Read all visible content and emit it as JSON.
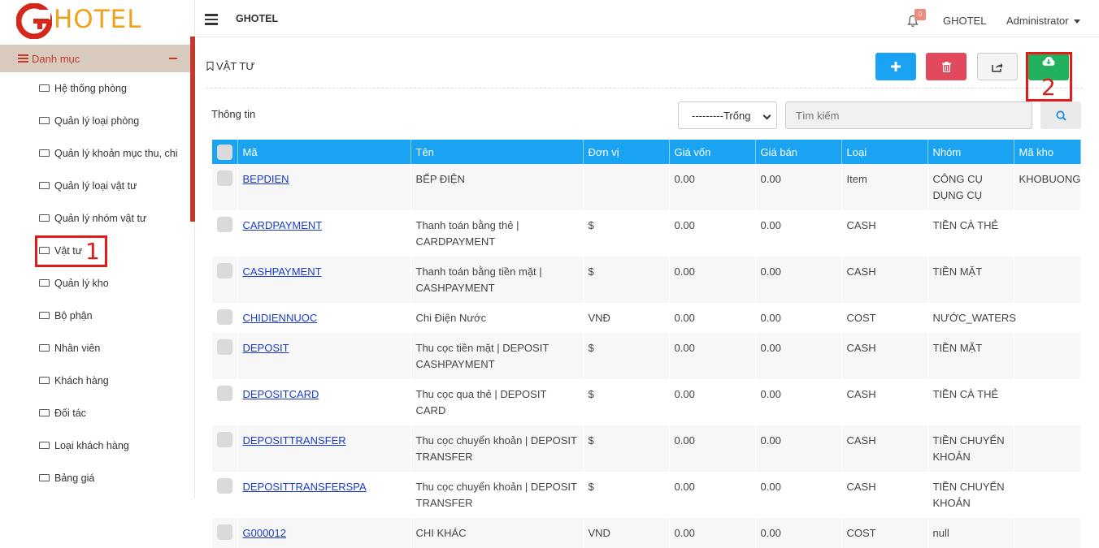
{
  "logo": {
    "text": "HOTEL"
  },
  "sidebar": {
    "header": "Danh mục",
    "items": [
      {
        "label": "Hệ thống phòng"
      },
      {
        "label": "Quản lý loại phòng"
      },
      {
        "label": "Quản lý khoản mục thu, chi"
      },
      {
        "label": "Quản lý loại vật tư"
      },
      {
        "label": "Quản lý nhóm vật tư"
      },
      {
        "label": "Vật tư"
      },
      {
        "label": "Quản lý kho"
      },
      {
        "label": "Bộ phận"
      },
      {
        "label": "Nhân viên"
      },
      {
        "label": "Khách hàng"
      },
      {
        "label": "Đối tác"
      },
      {
        "label": "Loại khách hàng"
      },
      {
        "label": "Bảng giá"
      }
    ]
  },
  "annotations": {
    "one": "1",
    "two": "2"
  },
  "topbar": {
    "title": "GHOTEL",
    "notification_count": "0",
    "hotel": "GHOTEL",
    "user": "Administrator"
  },
  "page": {
    "title": "VẬT TƯ",
    "info_label": "Thông tin",
    "filter_selected": "---------Trống",
    "search_placeholder": "Tìm kiếm"
  },
  "table": {
    "columns": [
      "Mã",
      "Tên",
      "Đơn vị",
      "Giá vốn",
      "Giá bán",
      "Loại",
      "Nhóm",
      "Mã kho"
    ],
    "rows": [
      {
        "ma": "BEPDIEN",
        "ten": "BẾP ĐIỆN",
        "donvi": "",
        "giavon": "0.00",
        "giaban": "0.00",
        "loai": "Item",
        "nhom": "CÔNG CỤ DỤNG CỤ",
        "makho": "KHOBUONG"
      },
      {
        "ma": "CARDPAYMENT",
        "ten": "Thanh toán bằng thẻ | CARDPAYMENT",
        "donvi": "$",
        "giavon": "0.00",
        "giaban": "0.00",
        "loai": "CASH",
        "nhom": "TIỀN CÀ THẺ",
        "makho": ""
      },
      {
        "ma": "CASHPAYMENT",
        "ten": "Thanh toán bằng tiền mặt | CASHPAYMENT",
        "donvi": "$",
        "giavon": "0.00",
        "giaban": "0.00",
        "loai": "CASH",
        "nhom": "TIỀN MẶT",
        "makho": ""
      },
      {
        "ma": "CHIDIENNUOC",
        "ten": "Chi Điện Nước",
        "donvi": "VNĐ",
        "giavon": "0.00",
        "giaban": "0.00",
        "loai": "COST",
        "nhom": "NƯỚC_WATERS",
        "makho": ""
      },
      {
        "ma": "DEPOSIT",
        "ten": "Thu cọc tiền mặt | DEPOSIT CASHPAYMENT",
        "donvi": "$",
        "giavon": "0.00",
        "giaban": "0.00",
        "loai": "CASH",
        "nhom": "TIỀN MẶT",
        "makho": ""
      },
      {
        "ma": "DEPOSITCARD",
        "ten": "Thu cọc qua thẻ | DEPOSIT CARD",
        "donvi": "$",
        "giavon": "0.00",
        "giaban": "0.00",
        "loai": "CASH",
        "nhom": "TIỀN CÀ THẺ",
        "makho": ""
      },
      {
        "ma": "DEPOSITTRANSFER",
        "ten": "Thu cọc chuyển khoản | DEPOSIT TRANSFER",
        "donvi": "$",
        "giavon": "0.00",
        "giaban": "0.00",
        "loai": "CASH",
        "nhom": "TIỀN CHUYỂN KHOẢN",
        "makho": ""
      },
      {
        "ma": "DEPOSITTRANSFERSPA",
        "ten": "Thu cọc chuyển khoản | DEPOSIT TRANSFER",
        "donvi": "$",
        "giavon": "0.00",
        "giaban": "0.00",
        "loai": "CASH",
        "nhom": "TIỀN CHUYỂN KHOẢN",
        "makho": ""
      },
      {
        "ma": "G000012",
        "ten": "CHI KHÁC",
        "donvi": "VND",
        "giavon": "0.00",
        "giaban": "0.00",
        "loai": "COST",
        "nhom": "null",
        "makho": ""
      }
    ]
  }
}
